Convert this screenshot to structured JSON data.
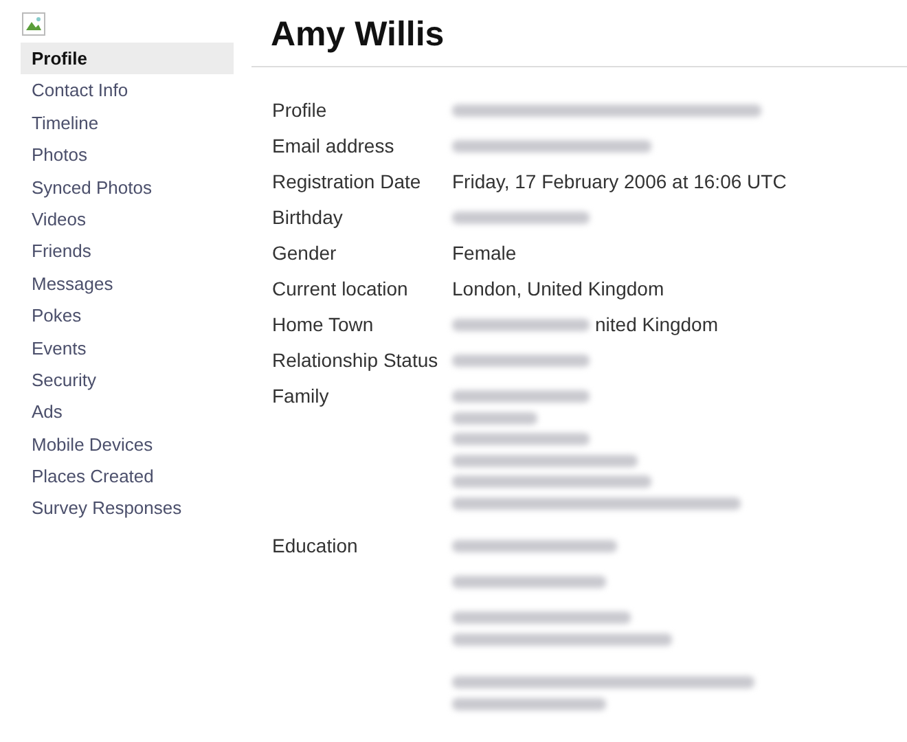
{
  "sidebar": {
    "items": [
      {
        "label": "Profile",
        "selected": true
      },
      {
        "label": "Contact Info",
        "selected": false
      },
      {
        "label": "Timeline",
        "selected": false
      },
      {
        "label": "Photos",
        "selected": false
      },
      {
        "label": "Synced Photos",
        "selected": false
      },
      {
        "label": "Videos",
        "selected": false
      },
      {
        "label": "Friends",
        "selected": false
      },
      {
        "label": "Messages",
        "selected": false
      },
      {
        "label": "Pokes",
        "selected": false
      },
      {
        "label": "Events",
        "selected": false
      },
      {
        "label": "Security",
        "selected": false
      },
      {
        "label": "Ads",
        "selected": false
      },
      {
        "label": "Mobile Devices",
        "selected": false
      },
      {
        "label": "Places Created",
        "selected": false
      },
      {
        "label": "Survey Responses",
        "selected": false
      }
    ]
  },
  "heading": "Amy Willis",
  "rows": [
    {
      "label": "Profile",
      "entries": [
        [
          [
            {
              "kind": "redacted"
            }
          ]
        ]
      ]
    },
    {
      "label": "Email address",
      "entries": [
        [
          [
            {
              "kind": "redacted"
            }
          ]
        ]
      ]
    },
    {
      "label": "Registration Date",
      "entries": [
        [
          [
            {
              "kind": "text",
              "text": "Friday, 17 February 2006 at 16:06 UTC"
            }
          ]
        ]
      ]
    },
    {
      "label": "Birthday",
      "entries": [
        [
          [
            {
              "kind": "redacted"
            }
          ]
        ]
      ]
    },
    {
      "label": "Gender",
      "entries": [
        [
          [
            {
              "kind": "text",
              "text": "Female"
            }
          ]
        ]
      ]
    },
    {
      "label": "Current location",
      "entries": [
        [
          [
            {
              "kind": "text",
              "text": "London, United Kingdom"
            }
          ]
        ]
      ]
    },
    {
      "label": "Home Town",
      "entries": [
        [
          [
            {
              "kind": "redacted"
            },
            {
              "kind": "text",
              "text": "nited Kingdom"
            }
          ]
        ]
      ]
    },
    {
      "label": "Relationship Status",
      "entries": [
        [
          [
            {
              "kind": "redacted"
            }
          ]
        ]
      ]
    },
    {
      "label": "Family",
      "entries": [
        [
          [
            {
              "kind": "redacted"
            }
          ],
          [
            {
              "kind": "redacted"
            }
          ],
          [
            {
              "kind": "redacted"
            }
          ],
          [
            {
              "kind": "redacted"
            }
          ],
          [
            {
              "kind": "redacted"
            }
          ],
          [
            {
              "kind": "redacted"
            }
          ]
        ]
      ]
    },
    {
      "label": "Education",
      "entries": [
        [
          [
            {
              "kind": "redacted"
            }
          ]
        ],
        [
          [
            {
              "kind": "redacted"
            }
          ]
        ],
        [
          [
            {
              "kind": "redacted"
            }
          ],
          [
            {
              "kind": "redacted"
            }
          ]
        ],
        [
          [
            {
              "kind": "redacted"
            }
          ],
          [
            {
              "kind": "redacted"
            }
          ]
        ]
      ]
    }
  ]
}
